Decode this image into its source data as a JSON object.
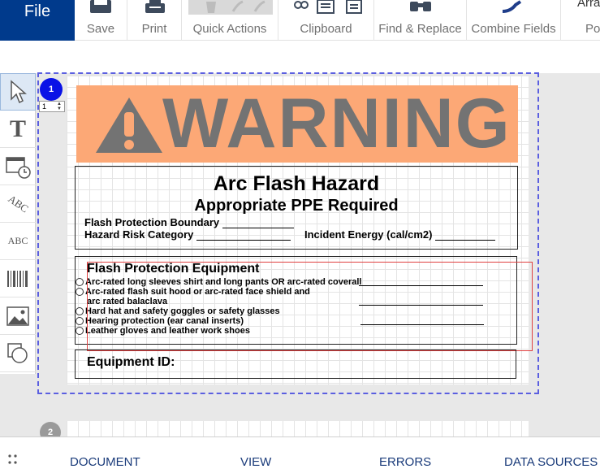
{
  "ribbon": {
    "file_label": "File",
    "groups": [
      {
        "label": "Save",
        "icon": "save-icon"
      },
      {
        "label": "Print",
        "icon": "print-icon"
      },
      {
        "label": "Quick Actions",
        "icon": "quick-actions-icon"
      },
      {
        "label": "Clipboard",
        "icon": "clipboard-icon"
      },
      {
        "label": "Find & Replace",
        "icon": "binoculars-icon"
      },
      {
        "label": "Combine Fields",
        "icon": "combine-fields-icon"
      },
      {
        "label": "Pos",
        "icon": "position-icon"
      }
    ],
    "top_right_partial": "Arra"
  },
  "toolbox": {
    "tools": [
      {
        "name": "select-tool",
        "icon": "cursor-icon"
      },
      {
        "name": "text-tool",
        "icon": "text-icon"
      },
      {
        "name": "date-time-tool",
        "icon": "calendar-clock-icon"
      },
      {
        "name": "arc-text-tool",
        "icon": "arc-text-icon"
      },
      {
        "name": "text-line-tool",
        "icon": "text-line-icon"
      },
      {
        "name": "barcode-tool",
        "icon": "barcode-icon"
      },
      {
        "name": "picture-tool",
        "icon": "picture-icon"
      },
      {
        "name": "shape-tool",
        "icon": "shape-icon"
      }
    ],
    "glyph_text": "T",
    "abc_arc": "ABC",
    "abc_line": "ABC"
  },
  "pages": {
    "page1_number": "1",
    "page1_step_value": "1",
    "page2_number": "2"
  },
  "label": {
    "warning": "WARNING",
    "title": "Arc Flash Hazard",
    "subtitle": "Appropriate PPE Required",
    "boundary": "Flash Protection Boundary",
    "risk": "Hazard Risk Category",
    "energy": "Incident Energy (cal/cm2)",
    "equipment_title": "Flash Protection Equipment",
    "equipment_items": [
      "Arc-rated long sleeves shirt and long pants OR arc-rated coverall",
      "Arc-rated flash suit hood or arc-rated face shield and",
      "Hard hat and safety goggles or safety glasses",
      "Hearing protection (ear canal inserts)",
      "Leather gloves and leather work shoes"
    ],
    "equipment_item2_cont": "arc rated balaclava",
    "equipment_id": "Equipment ID:"
  },
  "bottom_tabs": [
    "DOCUMENT",
    "VIEW",
    "ERRORS",
    "DATA SOURCES"
  ],
  "colors": {
    "file_blue": "#003a8c",
    "warning_orange": "#fca876",
    "warning_gray": "#737373",
    "page_badge_blue": "#0a12e6",
    "selection_red": "#e04040",
    "page_dash_blue": "#5b5fe0"
  }
}
